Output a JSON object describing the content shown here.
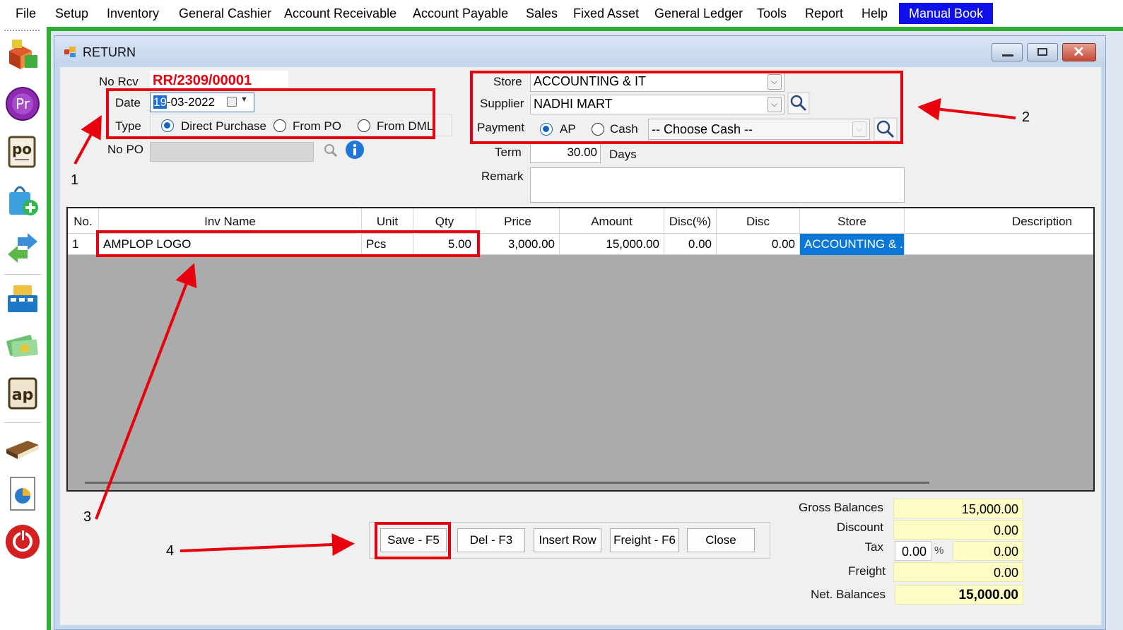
{
  "menu": {
    "items": [
      "File",
      "Setup",
      "Inventory",
      "General Cashier",
      "Account Receivable",
      "Account Payable",
      "Sales",
      "Fixed Asset",
      "General Ledger",
      "Tools",
      "Report",
      "Help"
    ],
    "highlight": "Manual Book"
  },
  "toolbar": {
    "icons": [
      "inventory-cubes-icon",
      "purchase-request-icon",
      "purchase-order-icon",
      "shopping-bag-add-icon",
      "transfer-arrows-icon",
      "cash-register-icon",
      "money-icon",
      "account-payable-icon",
      "ledger-book-icon",
      "report-chart-icon",
      "power-icon"
    ]
  },
  "window": {
    "title": "RETURN"
  },
  "form": {
    "no_rcv_label": "No Rcv",
    "no_rcv_value": "RR/2309/00001",
    "date_label": "Date",
    "date_value_sel": "19",
    "date_value_rest": "-03-2022",
    "type_label": "Type",
    "type_options": [
      "Direct Purchase",
      "From PO",
      "From DML"
    ],
    "type_selected": "Direct Purchase",
    "no_po_label": "No PO",
    "no_po_value": "",
    "store_label": "Store",
    "store_value": "ACCOUNTING & IT",
    "supplier_label": "Supplier",
    "supplier_value": "NADHI MART",
    "payment_label": "Payment",
    "payment_options": [
      "AP",
      "Cash"
    ],
    "payment_selected": "AP",
    "cash_placeholder": "-- Choose Cash --",
    "term_label": "Term",
    "term_value": "30.00",
    "term_unit": "Days",
    "remark_label": "Remark",
    "remark_value": ""
  },
  "grid": {
    "columns": [
      "No.",
      "Inv Name",
      "Unit",
      "Qty",
      "Price",
      "Amount",
      "Disc(%)",
      "Disc",
      "Store",
      "Description"
    ],
    "rows": [
      {
        "no": "1",
        "inv_name": "AMPLOP LOGO",
        "unit": "Pcs",
        "qty": "5.00",
        "price": "3,000.00",
        "amount": "15,000.00",
        "disc_pct": "0.00",
        "disc": "0.00",
        "store": "ACCOUNTING & ...",
        "description": ""
      }
    ]
  },
  "buttons": {
    "save": "Save - F5",
    "del": "Del - F3",
    "insert": "Insert Row",
    "freight": "Freight - F6",
    "close": "Close"
  },
  "totals": {
    "gross_label": "Gross Balances",
    "gross_value": "15,000.00",
    "discount_label": "Discount",
    "discount_value": "0.00",
    "tax_label": "Tax",
    "tax_pct": "0.00",
    "tax_pct_sign": "%",
    "tax_value": "0.00",
    "freight_label": "Freight",
    "freight_value": "0.00",
    "net_label": "Net. Balances",
    "net_value": "15,000.00"
  },
  "annotations": {
    "labels": [
      "1",
      "2",
      "3",
      "4"
    ],
    "color": "#e8000e"
  },
  "colors": {
    "menu_highlight": "#1010e8",
    "frame_green": "#2fae2f",
    "selected_cell": "#0b78d8",
    "no_rcv_red": "#e8000e",
    "total_yellow": "#fcfcc4"
  }
}
